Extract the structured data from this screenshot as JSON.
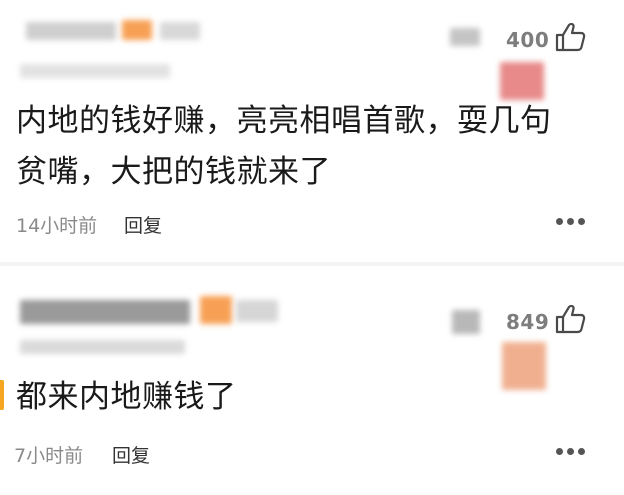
{
  "comments": [
    {
      "likes": "400",
      "content_line1": "内地的钱好赚，亮亮相唱首歌，耍几句",
      "content_line2": "贫嘴，大把的钱就来了",
      "time": "14小时前",
      "reply_label": "回复"
    },
    {
      "likes": "849",
      "content_line1": "都来内地赚钱了",
      "time": "7小时前",
      "reply_label": "回复"
    }
  ],
  "icons": {
    "like": "thumbs-up-icon",
    "more": "more-dots-icon"
  },
  "colors": {
    "accent": "#f5a623",
    "text": "#1a1a1a",
    "meta": "#8a8a8a"
  }
}
